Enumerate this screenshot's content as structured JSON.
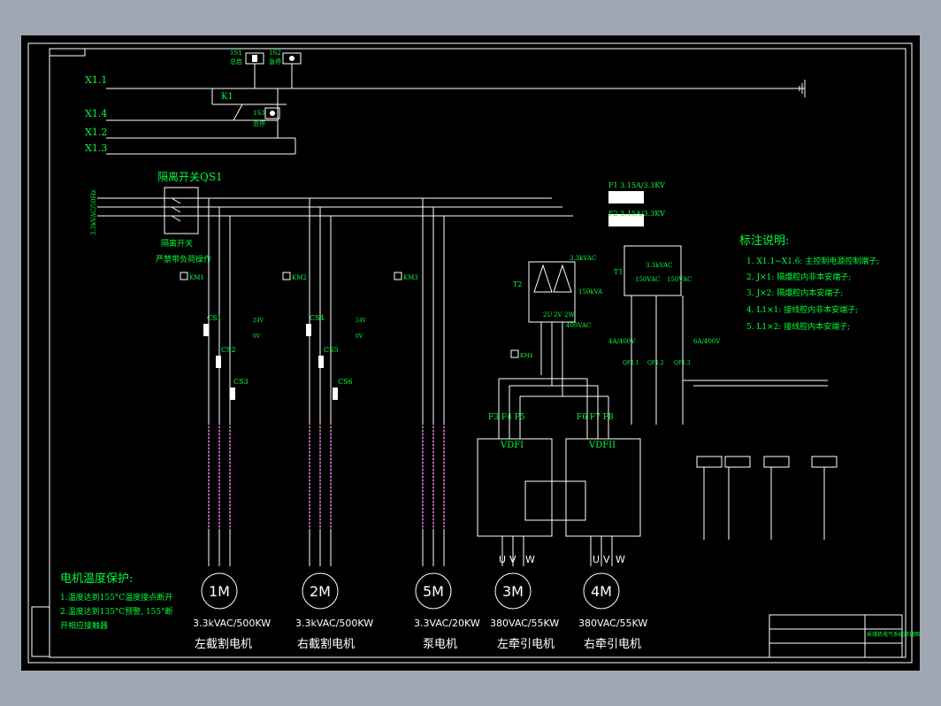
{
  "colors": {
    "background": "#a1a6b3",
    "drawing_bg": "#000000",
    "wire": "#ffffff",
    "label": "#00ff3c",
    "cable": "#c000c0"
  },
  "control": {
    "x11": "X1.1",
    "x14": "X1.4",
    "x12": "X1.2",
    "x13": "X1.3",
    "ss1": "1S1",
    "ss1_sub": "总启",
    "ss2": "1S2",
    "ss2_sub": "急停",
    "ss3": "1S3",
    "ss3_sub": "总停",
    "k1": "K1"
  },
  "power": {
    "supply": "3.3kVAC/50Hz",
    "qs1_title": "隔离开关QS1",
    "qs1_note1": "隔离开关",
    "qs1_note2": "严禁带负荷操作",
    "km1": "KM1",
    "km2": "KM2",
    "km3": "KM3",
    "km4": "KM4",
    "cs1": "CS1",
    "cs2": "CS2",
    "cs3": "CS3",
    "cs4": "CS4",
    "cs5": "CS5",
    "cs6": "CS6",
    "v24": "24V",
    "v0": "0V",
    "f1": "F1  3.15A/3.3KV",
    "f2": "F2  3.15A/3.3KV",
    "t1": "T1",
    "t1_top": "3.3kVAC",
    "t1_l": "150VAC",
    "t1_r": "150VAC",
    "t2": "T2",
    "t2_top": "3.3kVAC",
    "t2_va": "150kVA",
    "t2_bot": "400VAC",
    "t2_2u": "2U",
    "t2_2v": "2V",
    "t2_2w": "2W",
    "qf_left": "4A/400V",
    "qf_right": "6A/400V",
    "qf1": "QF1.1",
    "qf2": "QF1.2",
    "qf3": "QF1.3",
    "vdf1": "VDFI",
    "vdf2": "VDFII",
    "f3": "F3 F4 F5",
    "f6": "F6 F7 F8"
  },
  "motors": [
    {
      "id": "1M",
      "spec": "3.3kVAC/500KW",
      "name": "左截割电机"
    },
    {
      "id": "2M",
      "spec": "3.3kVAC/500KW",
      "name": "右截割电机"
    },
    {
      "id": "5M",
      "spec": "3.3VAC/20KW",
      "name": "泵电机"
    },
    {
      "id": "3M",
      "spec": "380VAC/55KW",
      "name": "左牵引电机"
    },
    {
      "id": "4M",
      "spec": "380VAC/55KW",
      "name": "右牵引电机"
    }
  ],
  "uvw": {
    "u": "U",
    "v": "V",
    "w": "W"
  },
  "legend": {
    "title": "标注说明:",
    "items": [
      "1. X1.1~X1.6: 主控制电源控制端子;",
      "2. J×1: 隔爆腔内非本安端子;",
      "3. J×2: 隔爆腔内本安端子;",
      "4. L1×1: 接线腔内非本安端子;",
      "5. L1×2: 接线腔内本安端子;"
    ]
  },
  "temp": {
    "title": "电机温度保护:",
    "l1": "1.温度达到155°C温度接点断开",
    "l2": "2.温度达到135°C预警, 155°断",
    "l3": "开相应接触器"
  },
  "title_block": {
    "name": "采煤机电气系统原理图"
  }
}
